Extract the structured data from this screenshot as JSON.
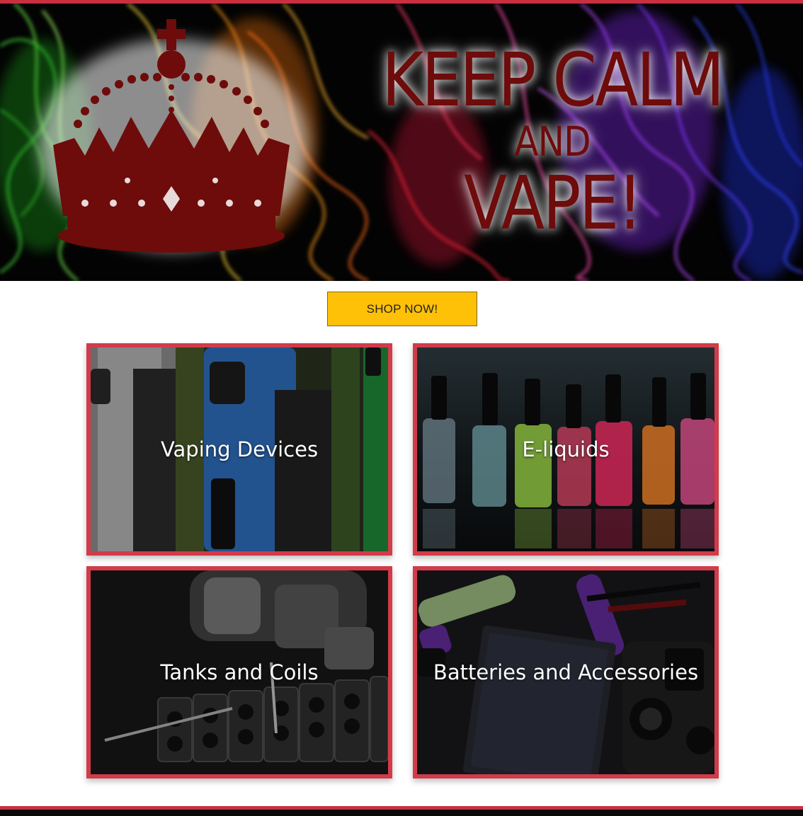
{
  "hero": {
    "line1": "KEEP CALM",
    "line2": "AND",
    "line3": "VAPE!"
  },
  "cta": {
    "label": "SHOP NOW!"
  },
  "categories": [
    {
      "label": "Vaping Devices"
    },
    {
      "label": "E-liquids"
    },
    {
      "label": "Tanks and Coils"
    },
    {
      "label": "Batteries and Accessories"
    }
  ],
  "colors": {
    "accent_border": "#d23b4a",
    "button": "#ffc107",
    "crown": "#6e0b0b"
  }
}
